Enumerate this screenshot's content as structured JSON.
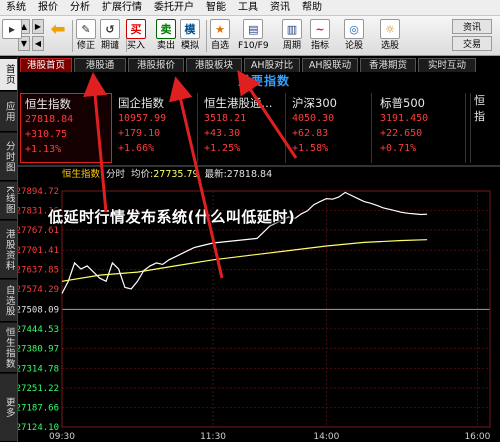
{
  "menu": [
    "系统",
    "报价",
    "分析",
    "扩展行情",
    "委托开户",
    "智能",
    "工具",
    "资讯",
    "帮助"
  ],
  "toolbar": {
    "left_buttons": [
      {
        "icon": "cursor-icon",
        "label": ""
      },
      {
        "icon": "back-arrow-icon",
        "label": ""
      }
    ],
    "buttons": [
      {
        "name": "modify",
        "label": "修正",
        "glyph": "✎"
      },
      {
        "name": "expire",
        "label": "期谴",
        "glyph": "↺"
      },
      {
        "name": "buy",
        "label": "买入",
        "glyph": "买"
      },
      {
        "name": "sell",
        "label": "卖出",
        "glyph": "卖"
      },
      {
        "name": "simulate",
        "label": "模拟",
        "glyph": "模"
      },
      {
        "name": "watchlist",
        "label": "自选",
        "glyph": "★"
      },
      {
        "name": "f10",
        "label": "F10/F9",
        "glyph": "▤"
      },
      {
        "name": "period",
        "label": "周期",
        "glyph": "▥"
      },
      {
        "name": "indicator",
        "label": "指标",
        "glyph": "~"
      },
      {
        "name": "forum",
        "label": "论股",
        "glyph": "◎"
      },
      {
        "name": "screener",
        "label": "选股",
        "glyph": "☼"
      }
    ],
    "right_small": [
      "资讯",
      "交易"
    ]
  },
  "sidebar": [
    {
      "label": "首页",
      "active": true
    },
    {
      "label": "应用",
      "active": false
    },
    {
      "label": "分时图",
      "active": false
    },
    {
      "label": "K线图",
      "active": false
    },
    {
      "label": "港股资料",
      "active": false
    },
    {
      "label": "自选股",
      "active": false
    },
    {
      "label": "恒生指数",
      "active": false
    },
    {
      "label": "更多",
      "active": false
    }
  ],
  "tabs": [
    {
      "label": "港股首页",
      "active": true
    },
    {
      "label": "港股通",
      "active": false
    },
    {
      "label": "港股报价",
      "active": false
    },
    {
      "label": "港股板块",
      "active": false
    },
    {
      "label": "AH股对比",
      "active": false
    },
    {
      "label": "AH股联动",
      "active": false
    },
    {
      "label": "香港期货",
      "active": false
    },
    {
      "label": "实时互动",
      "active": false
    }
  ],
  "section_title": "重要指数",
  "index_cards": [
    {
      "name": "恒生指数",
      "value": "27818.84",
      "change": "+310.75",
      "pct": "+1.13%",
      "selected": true
    },
    {
      "name": "国企指数",
      "value": "10957.99",
      "change": "+179.10",
      "pct": "+1.66%",
      "selected": false
    },
    {
      "name": "恒生港股通...",
      "value": "3518.21",
      "change": "+43.30",
      "pct": "+1.25%",
      "selected": false
    },
    {
      "name": "沪深300",
      "value": "4050.30",
      "change": "+62.83",
      "pct": "+1.58%",
      "selected": false
    },
    {
      "name": "标普500",
      "value": "3191.450",
      "change": "+22.650",
      "pct": "+0.71%",
      "selected": false
    }
  ],
  "right_panel_text": [
    "恒",
    "指"
  ],
  "chart_info": {
    "name": "恒生指数",
    "mode": "分时",
    "avg_label": "均价:",
    "avg_value": "27735.79",
    "latest_label": "最新:",
    "latest_value": "27818.84"
  },
  "overlay_title": "低延时行情发布系统(什么叫低延时)",
  "colors": {
    "up": "#ff3c3c",
    "down": "#33ff66",
    "neutral": "#e0e0e0",
    "price_line": "#ffffff",
    "avg_line": "#ffff66",
    "accent": "#33a0ff",
    "arrow": "#e02020"
  },
  "chart_data": {
    "type": "line",
    "title": "",
    "xlabel": "",
    "ylabel": "",
    "x_ticks": [
      "09:30",
      "11:30",
      "14:00",
      "16:00"
    ],
    "y_ticks": [
      27894.72,
      27831.16,
      27767.61,
      27701.41,
      27637.85,
      27574.29,
      27508.09,
      27444.53,
      27380.97,
      27314.78,
      27251.22,
      27187.66,
      27124.1
    ],
    "prev_close": 27508.09,
    "ylim": [
      27124.1,
      27894.72
    ],
    "series": [
      {
        "values_time": [
          "09:30",
          "09:35",
          "09:40",
          "09:45",
          "09:50",
          "09:55",
          "10:00",
          "10:05",
          "10:10",
          "10:15",
          "10:20",
          "10:25",
          "10:30",
          "10:35",
          "10:40",
          "10:45",
          "10:50",
          "10:55",
          "11:00",
          "11:05",
          "11:10",
          "11:15",
          "11:20",
          "11:25",
          "11:30",
          "13:05",
          "13:10",
          "13:15",
          "13:20",
          "13:25",
          "13:30",
          "13:35",
          "13:40",
          "13:45",
          "13:50",
          "13:55",
          "14:00",
          "14:05",
          "14:10",
          "14:15",
          "14:20",
          "14:25",
          "14:30",
          "14:35",
          "14:40",
          "14:45",
          "14:50",
          "14:55",
          "15:00",
          "15:05",
          "15:10",
          "15:15",
          "15:20"
        ],
        "values": [
          27560,
          27600,
          27660,
          27640,
          27650,
          27630,
          27610,
          27600,
          27660,
          27640,
          27580,
          27575,
          27600,
          27635,
          27650,
          27660,
          27655,
          27670,
          27680,
          27690,
          27700,
          27710,
          27715,
          27720,
          27725,
          27740,
          27760,
          27780,
          27790,
          27800,
          27810,
          27805,
          27820,
          27830,
          27850,
          27860,
          27870,
          27868,
          27875,
          27890,
          27880,
          27870,
          27860,
          27855,
          27848,
          27840,
          27835,
          27830,
          27825,
          27822,
          27820,
          27818,
          27818.84
        ]
      },
      {
        "values_time": [
          "09:30",
          "10:00",
          "10:30",
          "11:00",
          "11:30",
          "13:30",
          "14:00",
          "14:30",
          "15:00",
          "15:20"
        ],
        "values": [
          27600,
          27620,
          27630,
          27650,
          27670,
          27700,
          27715,
          27727,
          27733,
          27735.79
        ]
      }
    ],
    "grid": true
  }
}
